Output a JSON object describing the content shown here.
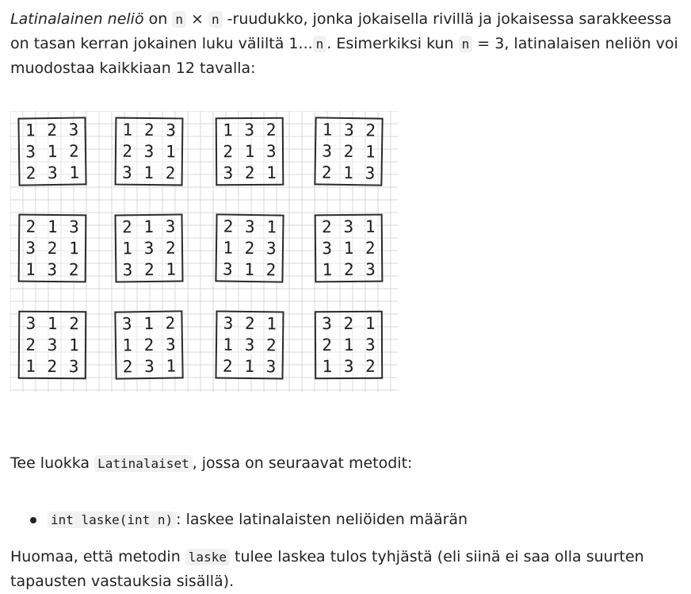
{
  "intro": {
    "term": "Latinalainen neliö",
    "on": " on ",
    "n1": "n",
    "times": " × ",
    "n2": "n",
    "rest1": " -ruudukko, jonka jokaisella rivillä ja jokaisessa sarakkeessa on tasan kerran jokainen luku väliltä 1...",
    "n3": "n",
    "rest2": ". Esimerkiksi kun ",
    "n4": "n",
    "rest3": " = 3, latinalaisen neliön voi muodostaa kaikkiaan 12 tavalla:"
  },
  "squares": [
    [
      [
        "1",
        "2",
        "3"
      ],
      [
        "3",
        "1",
        "2"
      ],
      [
        "2",
        "3",
        "1"
      ]
    ],
    [
      [
        "1",
        "2",
        "3"
      ],
      [
        "2",
        "3",
        "1"
      ],
      [
        "3",
        "1",
        "2"
      ]
    ],
    [
      [
        "1",
        "3",
        "2"
      ],
      [
        "2",
        "1",
        "3"
      ],
      [
        "3",
        "2",
        "1"
      ]
    ],
    [
      [
        "1",
        "3",
        "2"
      ],
      [
        "3",
        "2",
        "1"
      ],
      [
        "2",
        "1",
        "3"
      ]
    ],
    [
      [
        "2",
        "1",
        "3"
      ],
      [
        "3",
        "2",
        "1"
      ],
      [
        "1",
        "3",
        "2"
      ]
    ],
    [
      [
        "2",
        "1",
        "3"
      ],
      [
        "1",
        "3",
        "2"
      ],
      [
        "3",
        "2",
        "1"
      ]
    ],
    [
      [
        "2",
        "3",
        "1"
      ],
      [
        "1",
        "2",
        "3"
      ],
      [
        "3",
        "1",
        "2"
      ]
    ],
    [
      [
        "2",
        "3",
        "1"
      ],
      [
        "3",
        "1",
        "2"
      ],
      [
        "1",
        "2",
        "3"
      ]
    ],
    [
      [
        "3",
        "1",
        "2"
      ],
      [
        "2",
        "3",
        "1"
      ],
      [
        "1",
        "2",
        "3"
      ]
    ],
    [
      [
        "3",
        "1",
        "2"
      ],
      [
        "1",
        "2",
        "3"
      ],
      [
        "2",
        "3",
        "1"
      ]
    ],
    [
      [
        "3",
        "2",
        "1"
      ],
      [
        "1",
        "3",
        "2"
      ],
      [
        "2",
        "1",
        "3"
      ]
    ],
    [
      [
        "3",
        "2",
        "1"
      ],
      [
        "2",
        "1",
        "3"
      ],
      [
        "1",
        "3",
        "2"
      ]
    ]
  ],
  "task": {
    "before": "Tee luokka ",
    "class_name": "Latinalaiset",
    "after": ", jossa on seuraavat metodit:"
  },
  "methods": [
    {
      "signature": "int laske(int n)",
      "description": ": laskee latinalaisten neliöiden määrän"
    }
  ],
  "note": {
    "before": "Huomaa, että metodin ",
    "method": "laske",
    "after": " tulee laskea tulos tyhjästä (eli siinä ei saa olla suurten tapausten vastauksia sisällä)."
  }
}
